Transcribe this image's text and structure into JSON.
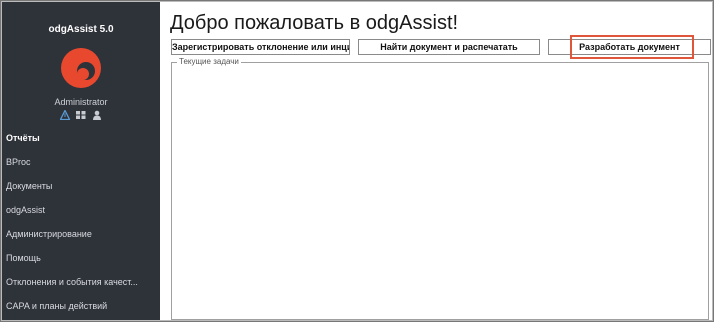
{
  "sidebar": {
    "app_title": "odgAssist 5.0",
    "username": "Administrator",
    "brand_color": "#e8492e",
    "user_icons": [
      "warning-icon",
      "grid-icon",
      "person-icon"
    ],
    "menu": [
      {
        "label": "Отчёты",
        "active": true
      },
      {
        "label": "BProc"
      },
      {
        "label": "Документы"
      },
      {
        "label": "odgAssist"
      },
      {
        "label": "Администрирование"
      },
      {
        "label": "Помощь"
      },
      {
        "label": "Отклонения и события качест..."
      },
      {
        "label": "CAPA и планы действий"
      }
    ]
  },
  "main": {
    "welcome": "Добро пожаловать в odgAssist!",
    "buttons": {
      "register_deviation": "Зарегистрировать отклонение или инцидент",
      "find_print": "Найти документ и распечатать",
      "develop_document": "Разработать документ"
    },
    "tasks_legend": "Текущие задачи",
    "highlight_color": "#e0563a"
  }
}
